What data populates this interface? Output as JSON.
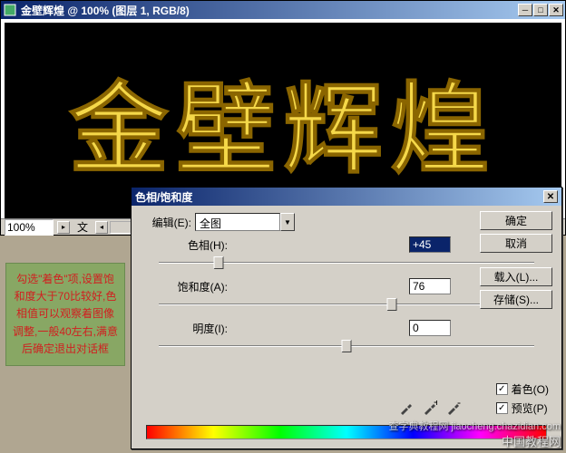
{
  "document_window": {
    "title": "金壁辉煌 @ 100% (图层 1, RGB/8)",
    "canvas_text": "金壁辉煌",
    "zoom": "100%",
    "status_char": "文"
  },
  "annotation": {
    "text": "勾选\"着色\"项,设置饱和度大于70比较好,色相值可以观察着图像调整,一般40左右,满意后确定退出对话框"
  },
  "dialog": {
    "title": "色相/饱和度",
    "edit_label": "编辑(E):",
    "edit_value": "全图",
    "hue": {
      "label": "色相(H):",
      "value": "+45",
      "pos": 16
    },
    "saturation": {
      "label": "饱和度(A):",
      "value": "76",
      "pos": 62
    },
    "lightness": {
      "label": "明度(I):",
      "value": "0",
      "pos": 50
    },
    "buttons": {
      "ok": "确定",
      "cancel": "取消",
      "load": "载入(L)...",
      "save": "存储(S)..."
    },
    "checks": {
      "colorize": {
        "label": "着色(O)",
        "checked": true
      },
      "preview": {
        "label": "预览(P)",
        "checked": true
      }
    }
  },
  "watermark": {
    "line1": "中国教程网",
    "line2": "查字典教程网 jiaocheng.chazidian.com"
  }
}
